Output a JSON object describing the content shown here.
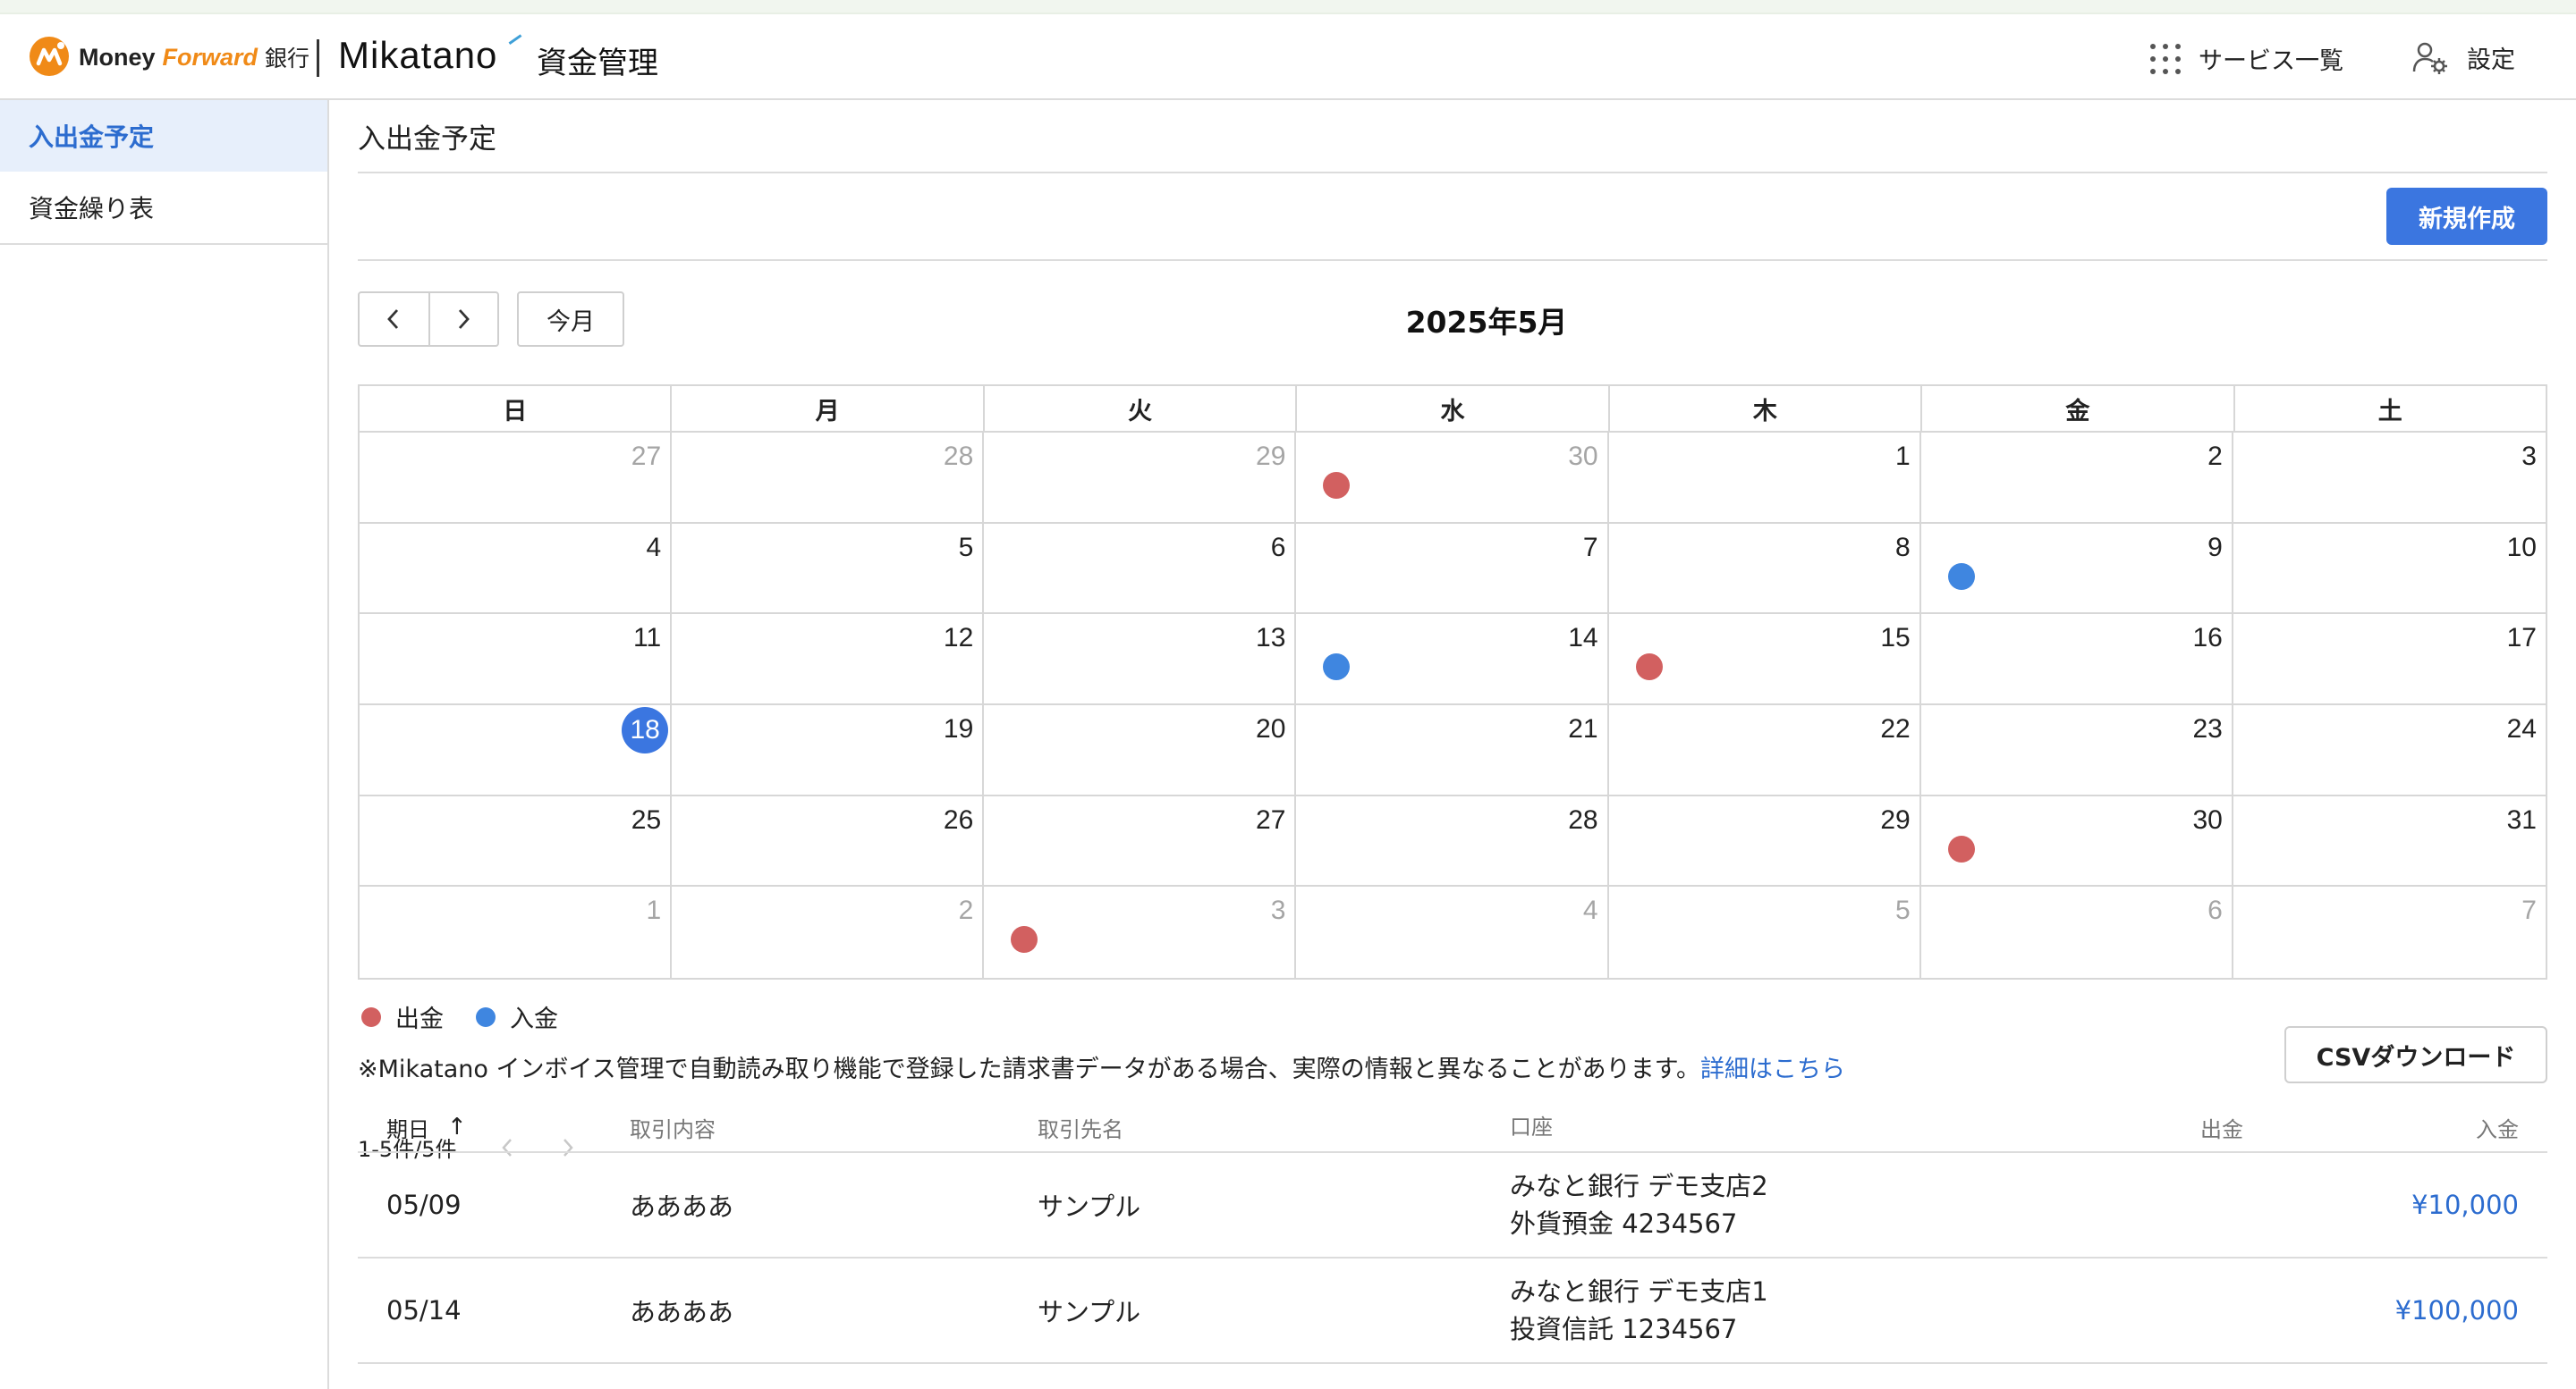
{
  "header": {
    "brand_money": "Money",
    "brand_forward": "Forward",
    "brand_bank": "銀行",
    "brand_mikatano": "Mikatano",
    "brand_product": "資金管理",
    "services_label": "サービス一覧",
    "settings_label": "設定"
  },
  "sidebar": {
    "items": [
      {
        "label": "入出金予定",
        "active": true
      },
      {
        "label": "資金繰り表",
        "active": false
      }
    ]
  },
  "main": {
    "page_title": "入出金予定",
    "new_button": "新規作成",
    "today_button": "今月",
    "month_title": "2025年5月",
    "weekdays": [
      "日",
      "月",
      "火",
      "水",
      "木",
      "金",
      "土"
    ],
    "legend": {
      "withdrawal": "出金",
      "deposit": "入金"
    },
    "notice_text": "※Mikatano インボイス管理で自動読み取り機能で登録した請求書データがある場合、実際の情報と異なることがあります。",
    "notice_link": "詳細はこちら",
    "pagination": "1-5件/5件",
    "csv_button": "CSVダウンロード"
  },
  "calendar": {
    "colors": {
      "withdrawal": "#d26060",
      "deposit": "#3f86e0",
      "today": "#3b76e0"
    },
    "today": 18,
    "cells": [
      {
        "day": "27",
        "other": true
      },
      {
        "day": "28",
        "other": true
      },
      {
        "day": "29",
        "other": true
      },
      {
        "day": "30",
        "other": true,
        "dot": "withdrawal"
      },
      {
        "day": "1"
      },
      {
        "day": "2"
      },
      {
        "day": "3"
      },
      {
        "day": "4"
      },
      {
        "day": "5"
      },
      {
        "day": "6"
      },
      {
        "day": "7"
      },
      {
        "day": "8"
      },
      {
        "day": "9",
        "dot": "deposit"
      },
      {
        "day": "10"
      },
      {
        "day": "11"
      },
      {
        "day": "12"
      },
      {
        "day": "13"
      },
      {
        "day": "14",
        "dot": "deposit"
      },
      {
        "day": "15",
        "dot": "withdrawal"
      },
      {
        "day": "16"
      },
      {
        "day": "17"
      },
      {
        "day": "18",
        "today": true
      },
      {
        "day": "19"
      },
      {
        "day": "20"
      },
      {
        "day": "21"
      },
      {
        "day": "22"
      },
      {
        "day": "23"
      },
      {
        "day": "24"
      },
      {
        "day": "25"
      },
      {
        "day": "26"
      },
      {
        "day": "27"
      },
      {
        "day": "28"
      },
      {
        "day": "29"
      },
      {
        "day": "30",
        "dot": "withdrawal"
      },
      {
        "day": "31"
      },
      {
        "day": "1",
        "other": true
      },
      {
        "day": "2",
        "other": true
      },
      {
        "day": "3",
        "other": true,
        "dot": "withdrawal"
      },
      {
        "day": "4",
        "other": true
      },
      {
        "day": "5",
        "other": true
      },
      {
        "day": "6",
        "other": true
      },
      {
        "day": "7",
        "other": true
      }
    ]
  },
  "table": {
    "columns": {
      "date": "期日",
      "description": "取引内容",
      "partner": "取引先名",
      "account": "口座",
      "withdrawal": "出金",
      "deposit": "入金"
    },
    "sort_indicator": "↑",
    "rows": [
      {
        "date": "05/09",
        "description": "ああああ",
        "partner": "サンプル",
        "account_line1": "みなと銀行 デモ支店2",
        "account_line2": "外貨預金 4234567",
        "withdrawal": "",
        "deposit": "¥10,000"
      },
      {
        "date": "05/14",
        "description": "ああああ",
        "partner": "サンプル",
        "account_line1": "みなと銀行 デモ支店1",
        "account_line2": "投資信託 1234567",
        "withdrawal": "",
        "deposit": "¥100,000"
      }
    ]
  }
}
